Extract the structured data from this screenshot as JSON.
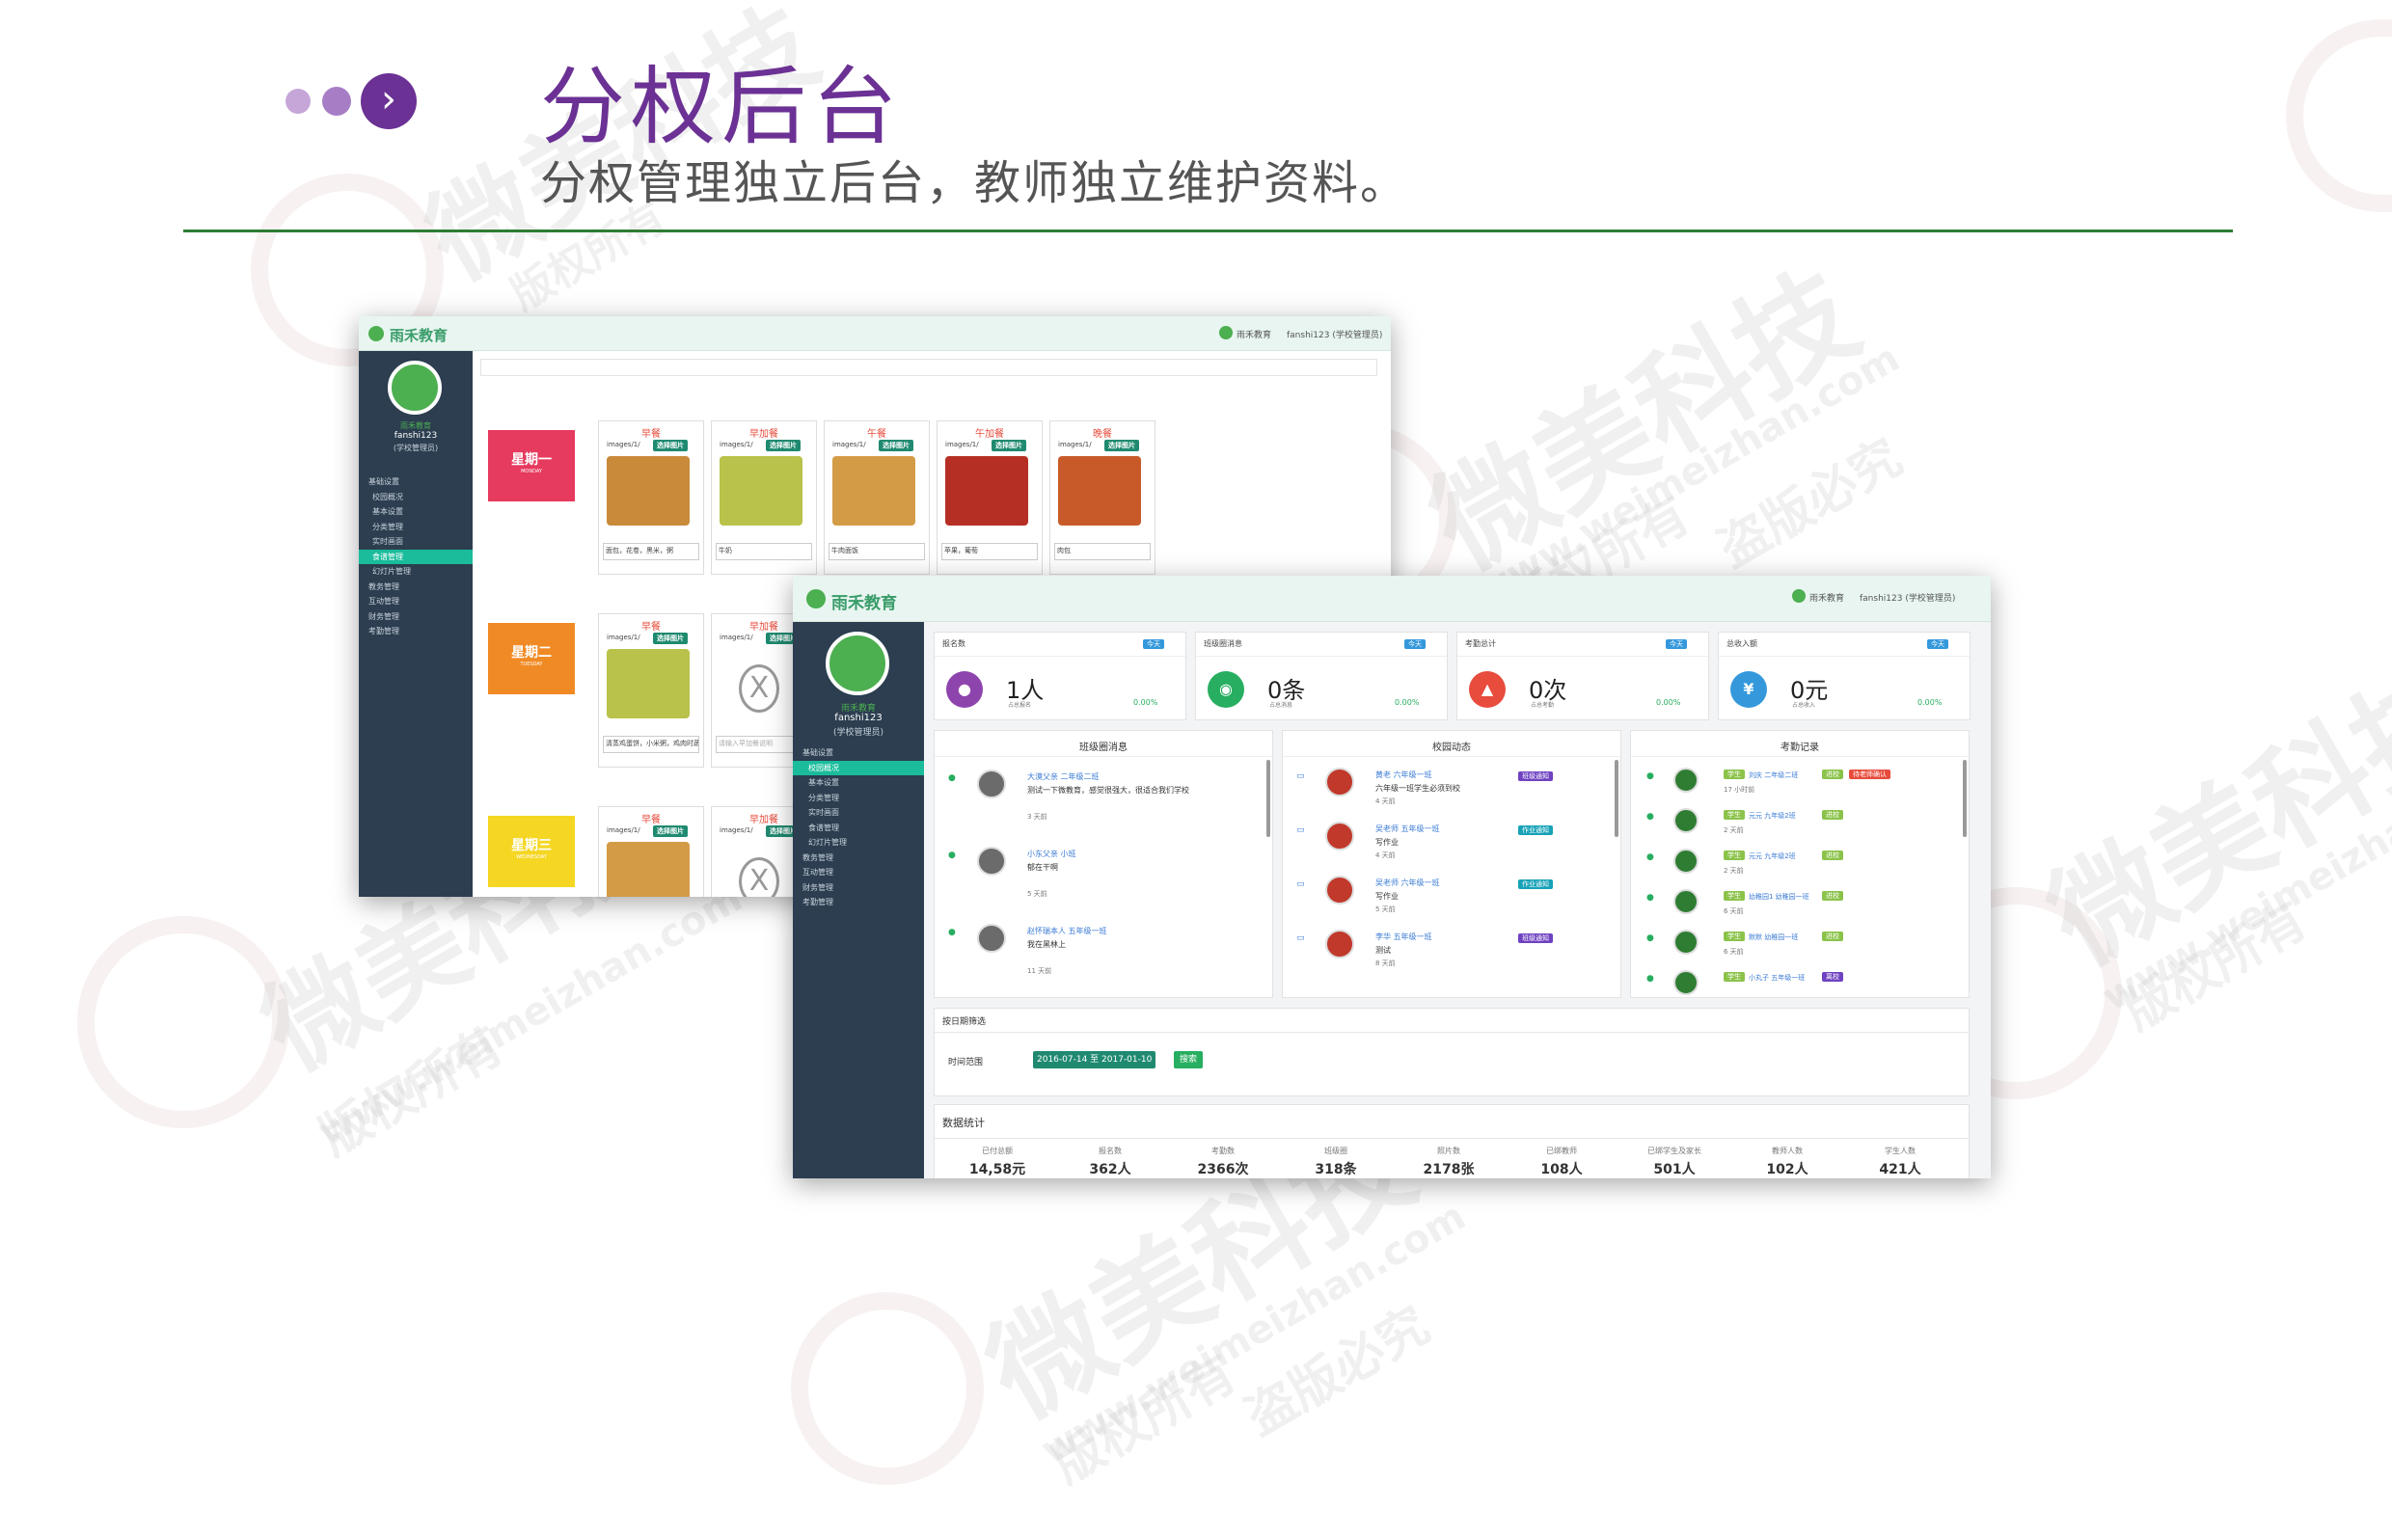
{
  "header": {
    "title": "分权后台",
    "subtitle": "分权管理独立后台，教师独立维护资料。"
  },
  "nav_icon": "chevron-right-icon",
  "watermark": {
    "brand": "微美科技",
    "url": "www.weimeizhan.com",
    "rights": "版权所有",
    "piracy": "盗版必究"
  },
  "back_window": {
    "brand": "雨禾教育",
    "top_school": "雨禾教育",
    "top_user": "fanshi123 (学校管理员)",
    "user": {
      "school": "雨禾教育",
      "name": "fanshi123",
      "role": "(学校管理员)"
    },
    "menu": [
      "基础设置",
      "校园概况",
      "基本设置",
      "分类管理",
      "实时画面",
      "食谱管理",
      "幻灯片管理",
      "教务管理",
      "互动管理",
      "财务管理",
      "考勤管理"
    ],
    "active_menu": "食谱管理",
    "days": [
      {
        "label": "星期一",
        "sub": "MONDAY",
        "color": "#e63a5e"
      },
      {
        "label": "星期二",
        "sub": "TUESDAY",
        "color": "#f08a24"
      },
      {
        "label": "星期三",
        "sub": "WEDNESDAY",
        "color": "#f5d623"
      }
    ],
    "monday": [
      {
        "meal": "早餐",
        "path": "images/1/",
        "btn": "选择图片",
        "desc": "面包，花卷，黑米，粥"
      },
      {
        "meal": "早加餐",
        "path": "images/1/",
        "btn": "选择图片",
        "desc": "牛奶"
      },
      {
        "meal": "午餐",
        "path": "images/1/",
        "btn": "选择图片",
        "desc": "牛肉面饭"
      },
      {
        "meal": "午加餐",
        "path": "images/1/",
        "btn": "选择图片",
        "desc": "苹果，葡萄"
      },
      {
        "meal": "晚餐",
        "path": "images/1/",
        "btn": "选择图片",
        "desc": "肉包"
      }
    ],
    "tuesday": [
      {
        "meal": "早餐",
        "path": "images/1/",
        "btn": "选择图片",
        "desc": "清蒸鸡蛋饼，小米粥，鸡肉时蔬菜"
      },
      {
        "meal": "早加餐",
        "path": "images/1/",
        "btn": "选择图片",
        "desc": "请输入早加餐说明"
      }
    ],
    "wednesday": [
      {
        "meal": "早餐",
        "path": "images/1/",
        "btn": "选择图片"
      },
      {
        "meal": "早加餐",
        "path": "images/1/",
        "btn": "选择图片"
      }
    ]
  },
  "front_window": {
    "brand": "雨禾教育",
    "top_school": "雨禾教育",
    "top_user": "fanshi123 (学校管理员)",
    "user": {
      "school": "雨禾教育",
      "name": "fanshi123",
      "role": "(学校管理员)"
    },
    "menu": [
      "基础设置",
      "校园概况",
      "基本设置",
      "分类管理",
      "实时画面",
      "食谱管理",
      "幻灯片管理",
      "教务管理",
      "互动管理",
      "财务管理",
      "考勤管理"
    ],
    "active_menu": "校园概况",
    "stats": [
      {
        "title": "报名数",
        "badge": "今天",
        "value": "1人",
        "sub": "占总报名",
        "pct": "0.00%",
        "color": "#8e44ad",
        "icon": "users-icon",
        "glyph": "●"
      },
      {
        "title": "班级圈消息",
        "badge": "今天",
        "value": "0条",
        "sub": "占总消息",
        "pct": "0.00%",
        "color": "#27ae60",
        "icon": "wechat-icon",
        "glyph": "◉"
      },
      {
        "title": "考勤总计",
        "badge": "今天",
        "value": "0次",
        "sub": "占总考勤",
        "pct": "0.00%",
        "color": "#e74c3c",
        "icon": "thumbs-up-icon",
        "glyph": "▲"
      },
      {
        "title": "总收入额",
        "badge": "今天",
        "value": "0元",
        "sub": "占总收入",
        "pct": "0.00%",
        "color": "#3498db",
        "icon": "yen-icon",
        "glyph": "¥"
      }
    ],
    "class_circle": {
      "title": "班级圈消息",
      "items": [
        {
          "name": "大漠父亲 二年级二班",
          "text": "测试一下微教育，感觉很强大，很适合我们学校",
          "time": "3 天前"
        },
        {
          "name": "小东父亲 小班",
          "text": "郁在干啊",
          "time": "5 天前"
        },
        {
          "name": "赵怀瑞本人 五年级一班",
          "text": "我在黑林上",
          "time": "11 天前"
        }
      ]
    },
    "campus": {
      "title": "校园动态",
      "items": [
        {
          "name": "黄老 六年级一班",
          "text": "六年级一班学生必须到校",
          "time": "4 天前",
          "tag": "班级通知",
          "tagColor": "#6f42c1"
        },
        {
          "name": "吴老师 五年级一班",
          "text": "写作业",
          "time": "4 天前",
          "tag": "作业通知",
          "tagColor": "#17a2b8"
        },
        {
          "name": "吴老师 六年级一班",
          "text": "写作业",
          "time": "5 天前",
          "tag": "作业通知",
          "tagColor": "#17a2b8"
        },
        {
          "name": "李华 五年级一班",
          "text": "测试",
          "time": "8 天前",
          "tag": "班级通知",
          "tagColor": "#6f42c1"
        }
      ]
    },
    "attendance": {
      "title": "考勤记录",
      "items": [
        {
          "who": "学生",
          "name": "刘庆 二年级二班",
          "tag": "进校",
          "time": "17 小时前",
          "extra": "待老师确认"
        },
        {
          "who": "学生",
          "name": "元元 九年级2班",
          "tag": "进校",
          "time": "2 天前"
        },
        {
          "who": "学生",
          "name": "元元 九年级2班",
          "tag": "进校",
          "time": "2 天前"
        },
        {
          "who": "学生",
          "name": "幼稚园1 幼稚园一班",
          "tag": "进校",
          "time": "6 天前"
        },
        {
          "who": "学生",
          "name": "默默 幼稚园一班",
          "tag": "进校",
          "time": "6 天前"
        },
        {
          "who": "学生",
          "name": "小丸子 五年级一班",
          "tag": "离校",
          "time": ""
        }
      ]
    },
    "filter": {
      "title": "按日期筛选",
      "label": "时间范围",
      "range": "2016-07-14 至 2017-01-10",
      "btn": "搜索"
    },
    "data_stats": {
      "title": "数据统计",
      "items": [
        {
          "label": "已付总额",
          "value": "14,58元"
        },
        {
          "label": "报名数",
          "value": "362人"
        },
        {
          "label": "考勤数",
          "value": "2366次"
        },
        {
          "label": "班级圈",
          "value": "318条"
        },
        {
          "label": "照片数",
          "value": "2178张"
        },
        {
          "label": "已绑教师",
          "value": "108人"
        },
        {
          "label": "已绑学生及家长",
          "value": "501人"
        },
        {
          "label": "教师人数",
          "value": "102人"
        },
        {
          "label": "学生人数",
          "value": "421人"
        }
      ]
    }
  }
}
